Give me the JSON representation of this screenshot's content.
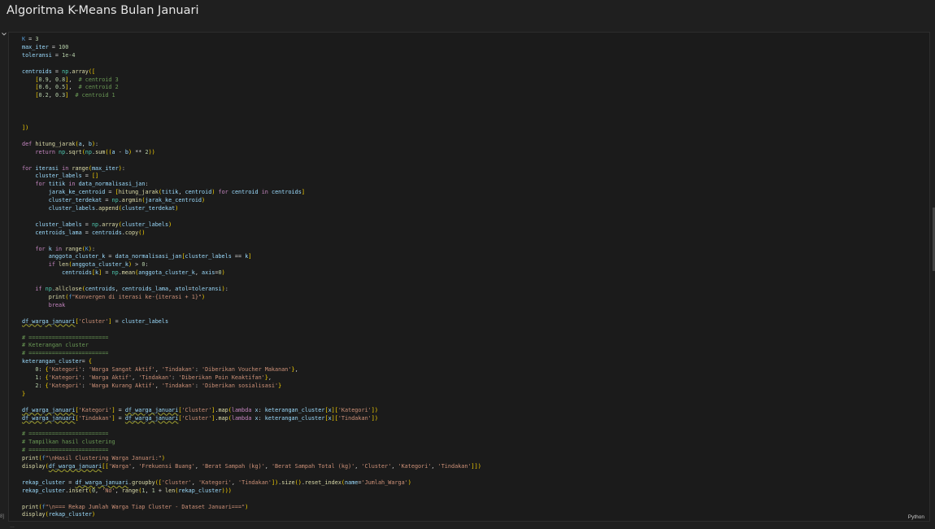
{
  "page": {
    "title": "Algoritma K-Means Bulan Januari"
  },
  "cell": {
    "language": "Python",
    "collapse_icon": "chevron-down-icon",
    "exec_marker": "8]",
    "status_text": "…"
  },
  "code": {
    "lines": [
      "K = 3",
      "max_iter = 100",
      "toleransi = 1e-4",
      "",
      "centroids = np.array([",
      "    [0.9, 0.8],  # centroid 3",
      "    [0.6, 0.5],  # centroid 2",
      "    [0.2, 0.3]  # centroid 1",
      "",
      "",
      "",
      "])",
      "",
      "def hitung_jarak(a, b):",
      "    return np.sqrt(np.sum((a - b) ** 2))",
      "",
      "for iterasi in range(max_iter):",
      "    cluster_labels = []",
      "    for titik in data_normalisasi_jan:",
      "        jarak_ke_centroid = [hitung_jarak(titik, centroid) for centroid in centroids]",
      "        cluster_terdekat = np.argmin(jarak_ke_centroid)",
      "        cluster_labels.append(cluster_terdekat)",
      "",
      "    cluster_labels = np.array(cluster_labels)",
      "    centroids_lama = centroids.copy()",
      "",
      "    for k in range(K):",
      "        anggota_cluster_k = data_normalisasi_jan[cluster_labels == k]",
      "        if len(anggota_cluster_k) > 0:",
      "            centroids[k] = np.mean(anggota_cluster_k, axis=0)",
      "",
      "    if np.allclose(centroids, centroids_lama, atol=toleransi):",
      "        print(f\"Konvergen di iterasi ke-{iterasi + 1}\")",
      "        break",
      "",
      "df_warga_januari['Cluster'] = cluster_labels",
      "",
      "# ========================",
      "# Keterangan cluster",
      "# ========================",
      "keterangan_cluster= {",
      "    0: {'Kategori': 'Warga Sangat Aktif', 'Tindakan': 'Diberikan Voucher Makanan'},",
      "    1: {'Kategori': 'Warga Aktif', 'Tindakan': 'Diberikan Poin Keaktifan'},",
      "    2: {'Kategori': 'Warga Kurang Aktif', 'Tindakan': 'Diberikan sosialisasi'}",
      "}",
      "",
      "df_warga_januari['Kategori'] = df_warga_januari['Cluster'].map(lambda x: keterangan_cluster[x]['Kategori'])",
      "df_warga_januari['Tindakan'] = df_warga_januari['Cluster'].map(lambda x: keterangan_cluster[x]['Tindakan'])",
      "",
      "# ========================",
      "# Tampilkan hasil clustering",
      "# ========================",
      "print(f\"\\nHasil Clustering Warga Januari:\")",
      "display(df_warga_januari[['Warga', 'Frekuensi Buang', 'Berat Sampah (kg)', 'Berat Sampah Total (kg)', 'Cluster', 'Kategori', 'Tindakan']])",
      "",
      "rekap_cluster = df_warga_januari.groupby(['Cluster', 'Kategori', 'Tindakan']).size().reset_index(name='Jumlah_Warga')",
      "rekap_cluster.insert(0, 'No', range(1, 1 + len(rekap_cluster)))",
      "",
      "print(f\"\\n=== Rekap Jumlah Warga Tiap Cluster - Dataset Januari===\")",
      "display(rekap_cluster)"
    ]
  },
  "colors": {
    "background": "#1f1f1f",
    "cell_background": "#1b1b1b",
    "keyword": "#c586c0",
    "function": "#dcdcaa",
    "string": "#ce9178",
    "number": "#b5cea8",
    "comment": "#6a9955",
    "variable": "#9cdcfe"
  }
}
